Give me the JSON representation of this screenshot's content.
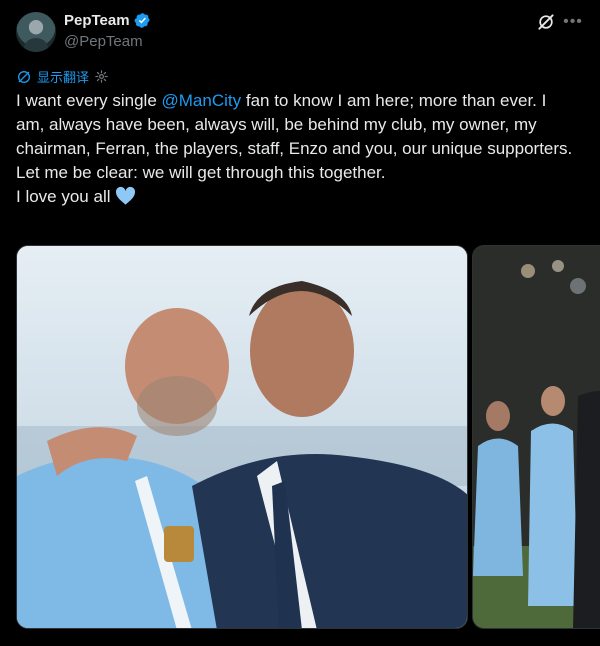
{
  "author": {
    "display_name": "PepTeam",
    "handle": "@PepTeam",
    "avatar_icon": "avatar-photo",
    "verified_icon": "verified-badge-icon"
  },
  "actions": {
    "grok_icon": "grok-icon",
    "more_icon": "more-icon"
  },
  "translate": {
    "label": "显示翻译",
    "icon": "translate-icon",
    "settings_icon": "gear-icon"
  },
  "tweet": {
    "line1_before": "I want every single ",
    "mention": "@ManCity",
    "line1_after": " fan to know I am here; more than ever. I am, always have been, always will, be behind my club, my owner, my chairman, Ferran, the players, staff, Enzo and you, our unique supporters.",
    "line2": "Let me be clear: we will get through this together.",
    "line3": "I love you all",
    "emoji_icon": "light-blue-heart-icon"
  },
  "media": [
    {
      "type": "photo",
      "description_icon": "photo-image"
    },
    {
      "type": "photo",
      "description_icon": "photo-image"
    }
  ],
  "colors": {
    "background": "#000000",
    "text": "#e7e9ea",
    "secondary": "#71767b",
    "accent": "#1d9bf0",
    "heart": "#8ec9f5"
  }
}
